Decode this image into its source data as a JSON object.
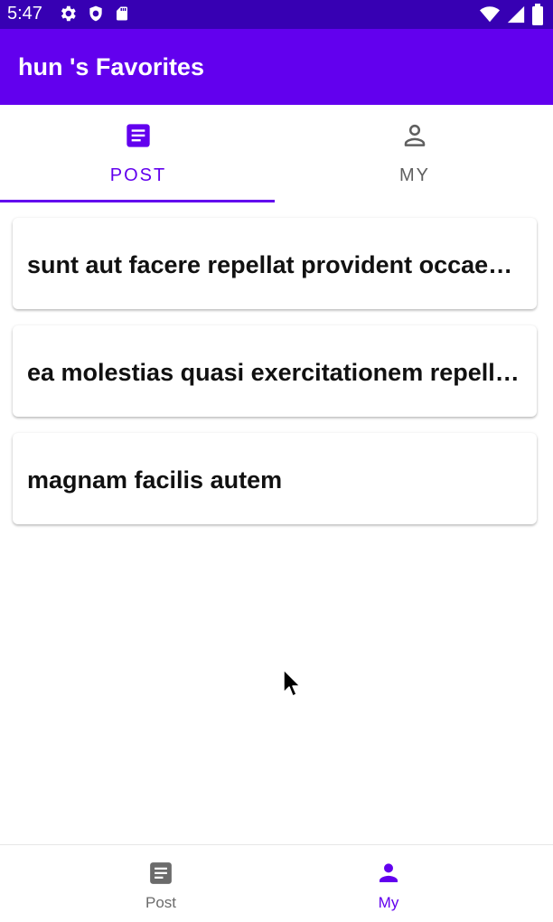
{
  "status_bar": {
    "time": "5:47",
    "left_icons": [
      "settings-icon",
      "shield-icon",
      "sd-card-icon"
    ],
    "right_icons": [
      "wifi-icon",
      "signal-icon",
      "battery-icon"
    ]
  },
  "app_bar": {
    "title": "hun 's Favorites"
  },
  "top_tabs": [
    {
      "label": "POST",
      "icon": "article-icon",
      "selected": true
    },
    {
      "label": "MY",
      "icon": "person-outline-icon",
      "selected": false
    }
  ],
  "posts": [
    {
      "title": "sunt aut facere repellat provident occaecati excepturi optio reprehenderit"
    },
    {
      "title": "ea molestias quasi exercitationem repellat qui ipsa sit aut"
    },
    {
      "title": "magnam facilis autem"
    }
  ],
  "bottom_nav": [
    {
      "label": "Post",
      "icon": "article-icon",
      "selected": false
    },
    {
      "label": "My",
      "icon": "person-icon",
      "selected": true
    }
  ],
  "colors": {
    "status_bar": "#3700b3",
    "primary": "#6200ee",
    "inactive": "#5f5f5f",
    "card_text": "#111111"
  }
}
